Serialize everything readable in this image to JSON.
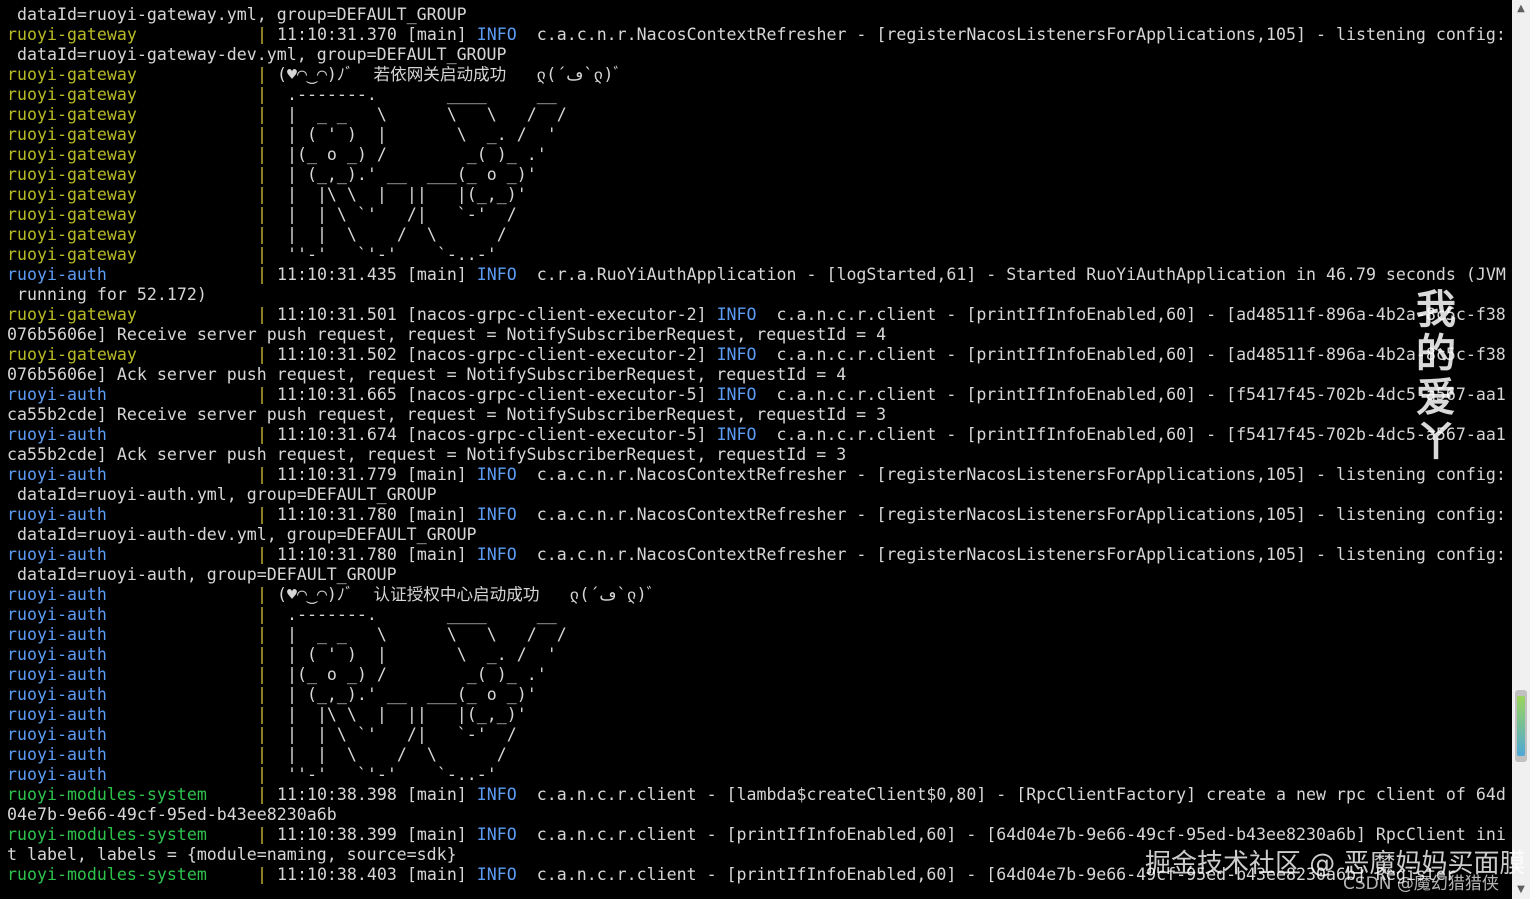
{
  "theme": {
    "background": "#000000",
    "text": "#d6d6d6",
    "service_colors": {
      "ruoyi-gateway": "#b8bb26",
      "ruoyi-auth": "#5c9cf5",
      "ruoyi-modules-system": "#2ec24c"
    },
    "separator_color": "#c8b232",
    "level_color": "#5c9cf5"
  },
  "lines": [
    {
      "text": " dataId=ruoyi-gateway.yml, group=DEFAULT_GROUP"
    },
    {
      "svc": "ruoyi-gateway",
      "sep": "| ",
      "pre": "11:10:31.370 [main] ",
      "lvl": "INFO",
      "post": "  c.a.c.n.r.NacosContextRefresher - [registerNacosListenersForApplications,105] - listening config:"
    },
    {
      "text": " dataId=ruoyi-gateway-dev.yml, group=DEFAULT_GROUP"
    },
    {
      "svc": "ruoyi-gateway",
      "sep": "| ",
      "post": "(♥◠‿◠)ﾉﾞ  若依网关启动成功   ლ(´ڡ`ლ)ﾞ"
    },
    {
      "svc": "ruoyi-gateway",
      "sep": "| ",
      "post": " .-------.       ____     __"
    },
    {
      "svc": "ruoyi-gateway",
      "sep": "| ",
      "post": " |  _ _   \\      \\   \\   /  /"
    },
    {
      "svc": "ruoyi-gateway",
      "sep": "| ",
      "post": " | ( ' )  |       \\  _. /  '"
    },
    {
      "svc": "ruoyi-gateway",
      "sep": "| ",
      "post": " |(_ o _) /        _( )_ .'"
    },
    {
      "svc": "ruoyi-gateway",
      "sep": "| ",
      "post": " | (_,_).' __  ___(_ o _)'"
    },
    {
      "svc": "ruoyi-gateway",
      "sep": "| ",
      "post": " |  |\\ \\  |  ||   |(_,_)'"
    },
    {
      "svc": "ruoyi-gateway",
      "sep": "| ",
      "post": " |  | \\ `'   /|   `-'  /"
    },
    {
      "svc": "ruoyi-gateway",
      "sep": "| ",
      "post": " |  |  \\    /  \\      /"
    },
    {
      "svc": "ruoyi-gateway",
      "sep": "| ",
      "post": " ''-'   `'-'    `-..-'"
    },
    {
      "svc": "ruoyi-auth",
      "sep": "| ",
      "pre": "11:10:31.435 [main] ",
      "lvl": "INFO",
      "post": "  c.r.a.RuoYiAuthApplication - [logStarted,61] - Started RuoYiAuthApplication in 46.79 seconds (JVM"
    },
    {
      "text": " running for 52.172)"
    },
    {
      "svc": "ruoyi-gateway",
      "sep": "| ",
      "pre": "11:10:31.501 [nacos-grpc-client-executor-2] ",
      "lvl": "INFO",
      "post": "  c.a.n.c.r.client - [printIfInfoEnabled,60] - [ad48511f-896a-4b2a-8c5c-f38"
    },
    {
      "text": "076b5606e] Receive server push request, request = NotifySubscriberRequest, requestId = 4"
    },
    {
      "svc": "ruoyi-gateway",
      "sep": "| ",
      "pre": "11:10:31.502 [nacos-grpc-client-executor-2] ",
      "lvl": "INFO",
      "post": "  c.a.n.c.r.client - [printIfInfoEnabled,60] - [ad48511f-896a-4b2a-8c5c-f38"
    },
    {
      "text": "076b5606e] Ack server push request, request = NotifySubscriberRequest, requestId = 4"
    },
    {
      "svc": "ruoyi-auth",
      "sep": "| ",
      "pre": "11:10:31.665 [nacos-grpc-client-executor-5] ",
      "lvl": "INFO",
      "post": "  c.a.n.c.r.client - [printIfInfoEnabled,60] - [f5417f45-702b-4dc5-a567-aa1"
    },
    {
      "text": "ca55b2cde] Receive server push request, request = NotifySubscriberRequest, requestId = 3"
    },
    {
      "svc": "ruoyi-auth",
      "sep": "| ",
      "pre": "11:10:31.674 [nacos-grpc-client-executor-5] ",
      "lvl": "INFO",
      "post": "  c.a.n.c.r.client - [printIfInfoEnabled,60] - [f5417f45-702b-4dc5-a567-aa1"
    },
    {
      "text": "ca55b2cde] Ack server push request, request = NotifySubscriberRequest, requestId = 3"
    },
    {
      "svc": "ruoyi-auth",
      "sep": "| ",
      "pre": "11:10:31.779 [main] ",
      "lvl": "INFO",
      "post": "  c.a.c.n.r.NacosContextRefresher - [registerNacosListenersForApplications,105] - listening config:"
    },
    {
      "text": " dataId=ruoyi-auth.yml, group=DEFAULT_GROUP"
    },
    {
      "svc": "ruoyi-auth",
      "sep": "| ",
      "pre": "11:10:31.780 [main] ",
      "lvl": "INFO",
      "post": "  c.a.c.n.r.NacosContextRefresher - [registerNacosListenersForApplications,105] - listening config:"
    },
    {
      "text": " dataId=ruoyi-auth-dev.yml, group=DEFAULT_GROUP"
    },
    {
      "svc": "ruoyi-auth",
      "sep": "| ",
      "pre": "11:10:31.780 [main] ",
      "lvl": "INFO",
      "post": "  c.a.c.n.r.NacosContextRefresher - [registerNacosListenersForApplications,105] - listening config:"
    },
    {
      "text": " dataId=ruoyi-auth, group=DEFAULT_GROUP"
    },
    {
      "svc": "ruoyi-auth",
      "sep": "| ",
      "post": "(♥◠‿◠)ﾉﾞ  认证授权中心启动成功   ლ(´ڡ`ლ)ﾞ"
    },
    {
      "svc": "ruoyi-auth",
      "sep": "| ",
      "post": " .-------.       ____     __"
    },
    {
      "svc": "ruoyi-auth",
      "sep": "| ",
      "post": " |  _ _   \\      \\   \\   /  /"
    },
    {
      "svc": "ruoyi-auth",
      "sep": "| ",
      "post": " | ( ' )  |       \\  _. /  '"
    },
    {
      "svc": "ruoyi-auth",
      "sep": "| ",
      "post": " |(_ o _) /        _( )_ .'"
    },
    {
      "svc": "ruoyi-auth",
      "sep": "| ",
      "post": " | (_,_).' __  ___(_ o _)'"
    },
    {
      "svc": "ruoyi-auth",
      "sep": "| ",
      "post": " |  |\\ \\  |  ||   |(_,_)'"
    },
    {
      "svc": "ruoyi-auth",
      "sep": "| ",
      "post": " |  | \\ `'   /|   `-'  /"
    },
    {
      "svc": "ruoyi-auth",
      "sep": "| ",
      "post": " |  |  \\    /  \\      /"
    },
    {
      "svc": "ruoyi-auth",
      "sep": "| ",
      "post": " ''-'   `'-'    `-..-'"
    },
    {
      "svc": "ruoyi-modules-system",
      "sep": "| ",
      "pre": "11:10:38.398 [main] ",
      "lvl": "INFO",
      "post": "  c.a.n.c.r.client - [lambda$createClient$0,80] - [RpcClientFactory] create a new rpc client of 64d"
    },
    {
      "text": "04e7b-9e66-49cf-95ed-b43ee8230a6b"
    },
    {
      "svc": "ruoyi-modules-system",
      "sep": "| ",
      "pre": "11:10:38.399 [main] ",
      "lvl": "INFO",
      "post": "  c.a.n.c.r.client - [printIfInfoEnabled,60] - [64d04e7b-9e66-49cf-95ed-b43ee8230a6b] RpcClient ini"
    },
    {
      "text": "t label, labels = {module=naming, source=sdk}"
    },
    {
      "svc": "ruoyi-modules-system",
      "sep": "| ",
      "pre": "11:10:38.403 [main] ",
      "lvl": "INFO",
      "post": "  c.a.n.c.r.client - [printIfInfoEnabled,60] - [64d04e7b-9e66-49cf-95ed-b43ee8230a6b] Register"
    }
  ],
  "scrollbar": {
    "up_icon": "▲",
    "down_icon": "▼"
  },
  "watermarks": {
    "vertical": "我的爱丫",
    "site": "掘金技术社区 @ 恶魔妈妈买面膜",
    "csdn": "CSDN @魔幻猎猎侠"
  }
}
